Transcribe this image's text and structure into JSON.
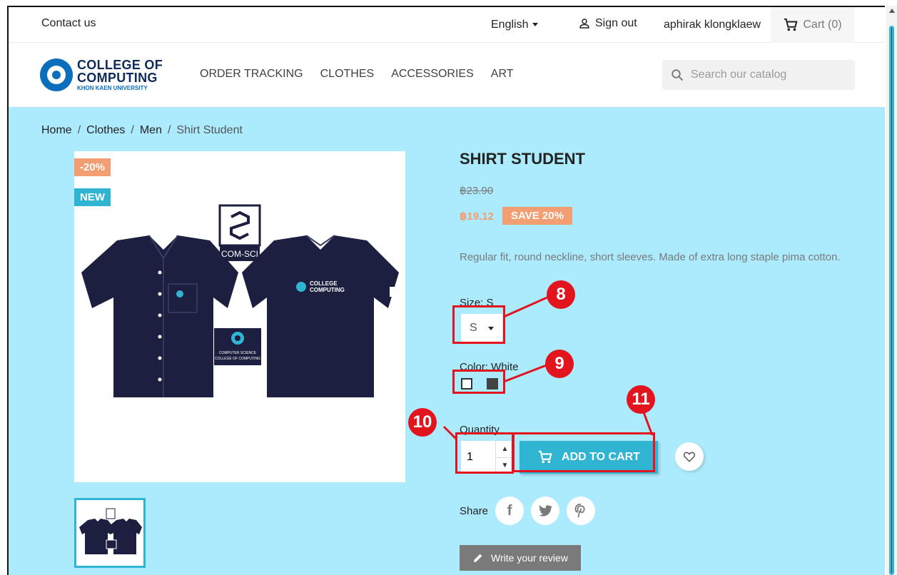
{
  "topbar": {
    "contact": "Contact us",
    "language": "English",
    "signout": "Sign out",
    "username": "aphirak klongklaew",
    "cart": "Cart (0)"
  },
  "logo": {
    "line1": "COLLEGE OF",
    "line2": "COMPUTING",
    "line3": "KHON KAEN UNIVERSITY"
  },
  "nav": [
    "ORDER TRACKING",
    "CLOTHES",
    "ACCESSORIES",
    "ART"
  ],
  "search": {
    "placeholder": "Search our catalog"
  },
  "breadcrumb": [
    "Home",
    "Clothes",
    "Men",
    "Shirt Student"
  ],
  "product": {
    "badges": {
      "discount": "-20%",
      "new": "NEW"
    },
    "title": "SHIRT STUDENT",
    "old_price": "฿23.90",
    "price": "฿19.12",
    "save": "SAVE 20%",
    "description": "Regular fit, round neckline, short sleeves. Made of extra long staple pima cotton.",
    "size_label": "Size: S",
    "size_value": "S",
    "color_label": "Color: White",
    "colors": [
      "White",
      "Dark grey"
    ],
    "quantity_label": "Quantity",
    "quantity_value": "1",
    "add_to_cart": "ADD TO CART",
    "share_label": "Share",
    "review_button": "Write your review",
    "image_text": {
      "comsci": "COM-SCI",
      "badge_line1": "COMPUTER SCIENCE",
      "badge_line2": "COLLEGE OF COMPUTING"
    }
  },
  "annotations": [
    "8",
    "9",
    "10",
    "11"
  ],
  "colors": {
    "accent": "#2fb5d2",
    "background": "#acebfd",
    "price": "#f39d72",
    "annotation": "#e2141e"
  }
}
